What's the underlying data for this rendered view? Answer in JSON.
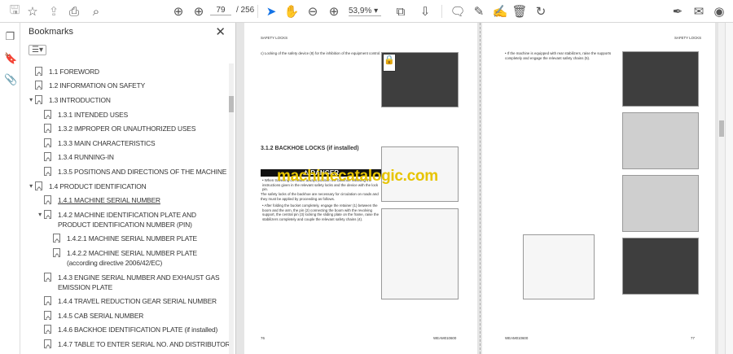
{
  "toolbar": {
    "page_current": "79",
    "page_total": "/ 256",
    "zoom": "53,9%"
  },
  "panel": {
    "title": "Bookmarks",
    "close": "✕",
    "options": "☰▾"
  },
  "bookmarks": [
    {
      "label": "1.1 FOREWORD",
      "level": 0,
      "exp": ""
    },
    {
      "label": "1.2 INFORMATION ON SAFETY",
      "level": 0,
      "exp": ""
    },
    {
      "label": "1.3 INTRODUCTION",
      "level": 0,
      "exp": "▾"
    },
    {
      "label": "1.3.1 INTENDED USES",
      "level": 1,
      "exp": ""
    },
    {
      "label": "1.3.2 IMPROPER OR UNAUTHORIZED USES",
      "level": 1,
      "exp": ""
    },
    {
      "label": "1.3.3 MAIN CHARACTERISTICS",
      "level": 1,
      "exp": ""
    },
    {
      "label": "1.3.4 RUNNING-IN",
      "level": 1,
      "exp": ""
    },
    {
      "label": "1.3.5 POSITIONS AND DIRECTIONS OF THE MACHINE",
      "level": 1,
      "exp": ""
    },
    {
      "label": "1.4 PRODUCT IDENTIFICATION",
      "level": 0,
      "exp": "▾"
    },
    {
      "label": "1.4.1 MACHINE SERIAL NUMBER",
      "level": 1,
      "exp": "",
      "selected": true
    },
    {
      "label": "1.4.2 MACHINE IDENTIFICATION PLATE AND PRODUCT IDENTIFICATION NUMBER (PIN)",
      "level": 1,
      "exp": "▾"
    },
    {
      "label": "1.4.2.1 MACHINE SERIAL NUMBER PLATE",
      "level": 2,
      "exp": ""
    },
    {
      "label": "1.4.2.2 MACHINE SERIAL NUMBER PLATE (according directive 2006/42/EC)",
      "level": 2,
      "exp": ""
    },
    {
      "label": "1.4.3 ENGINE SERIAL NUMBER AND EXHAUST GAS EMISSION PLATE",
      "level": 1,
      "exp": ""
    },
    {
      "label": "1.4.4 TRAVEL REDUCTION GEAR SERIAL NUMBER",
      "level": 1,
      "exp": ""
    },
    {
      "label": "1.4.5 CAB SERIAL NUMBER",
      "level": 1,
      "exp": ""
    },
    {
      "label": "1.4.6 BACKHOE IDENTIFICATION PLATE (if installed)",
      "level": 1,
      "exp": ""
    },
    {
      "label": "1.4.7 TABLE TO ENTER SERIAL NO. AND DISTRIBUTOR",
      "level": 1,
      "exp": ""
    }
  ],
  "page_left": {
    "header": "SAFETY LOCKS",
    "item_c": "c)   Locking of the safety device (8) for the inhibition of the equipment control.",
    "heading": "3.1.2   BACKHOE LOCKS (if installed)",
    "danger": "⚠ DANGER",
    "danger_text": "• When travelling on roads, always position the backhoe following the instructions given in the relevant safety locks and the device with the lock pin.",
    "body": "The safety locks of the backhoe are necessary for circulation on roads and they must be applied by proceeding as follows.",
    "bullet": "• After folding the bucket completely, engage the retainer (1) between the boom and the arm, the pin (2) connecting the boom with the revolving support, the central pin (3) locking the sliding plate on the frame, raise the stabilizers completely and couple the relevant safety chains (4).",
    "page_no": "76",
    "code": "WEAM010600"
  },
  "page_right": {
    "header": "SAFETY LOCKS",
    "bullet": "• If the machine is equipped with rear stabilizers, raise the supports completely and engage the relevant safety chains (5).",
    "page_no": "77",
    "code": "WEAM010600"
  },
  "watermark": "machinecatalogic.com"
}
